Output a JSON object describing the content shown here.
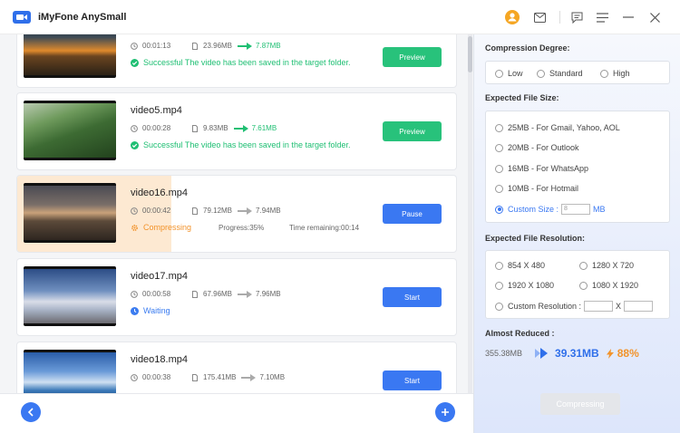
{
  "app": {
    "title": "iMyFone AnySmall"
  },
  "colors": {
    "accent": "#3a78f2",
    "success": "#1fbf73",
    "warning": "#f2932b"
  },
  "videos": [
    {
      "name": "",
      "duration": "00:01:13",
      "size": "23.96MB",
      "new_size": "7.87MB",
      "status": "Successful The video has been saved in the target folder.",
      "button": "Preview",
      "thumb": "sunset-lake"
    },
    {
      "name": "video5.mp4",
      "duration": "00:00:28",
      "size": "9.83MB",
      "new_size": "7.61MB",
      "status": "Successful The video has been saved in the target folder.",
      "button": "Preview",
      "thumb": "green-valley"
    },
    {
      "name": "video16.mp4",
      "duration": "00:00:42",
      "size": "79.12MB",
      "new_size": "7.94MB",
      "status": "Compressing",
      "progress": "Progress:35%",
      "remaining": "Time remaining:00:14",
      "button": "Pause",
      "progress_value": 0.35,
      "thumb": "rocky-dusk"
    },
    {
      "name": "video17.mp4",
      "duration": "00:00:58",
      "size": "67.96MB",
      "new_size": "7.96MB",
      "status": "Waiting",
      "button": "Start",
      "thumb": "snowy-forest"
    },
    {
      "name": "video18.mp4",
      "duration": "00:00:38",
      "size": "175.41MB",
      "new_size": "7.10MB",
      "status": "",
      "button": "Start",
      "thumb": "ocean-sky"
    }
  ],
  "settings": {
    "degree_title": "Compression Degree:",
    "degree_options": [
      "Low",
      "Standard",
      "High"
    ],
    "size_title": "Expected File Size:",
    "size_options": [
      "25MB - For Gmail, Yahoo, AOL",
      "20MB - For Outlook",
      "16MB - For WhatsApp",
      "10MB - For Hotmail"
    ],
    "custom_size_label": "Custom Size :",
    "custom_size_value": "8",
    "custom_size_unit": "MB",
    "resolution_title": "Expected File Resolution:",
    "resolution_options": [
      "854 X 480",
      "1280 X 720",
      "1920 X 1080",
      "1080 X 1920"
    ],
    "custom_resolution_label": "Custom Resolution :",
    "custom_resolution_x": "X",
    "reduced_title": "Almost Reduced :",
    "original_total": "355.38MB",
    "new_total": "39.31MB",
    "percent": "88%",
    "compress_button": "Compressing"
  }
}
